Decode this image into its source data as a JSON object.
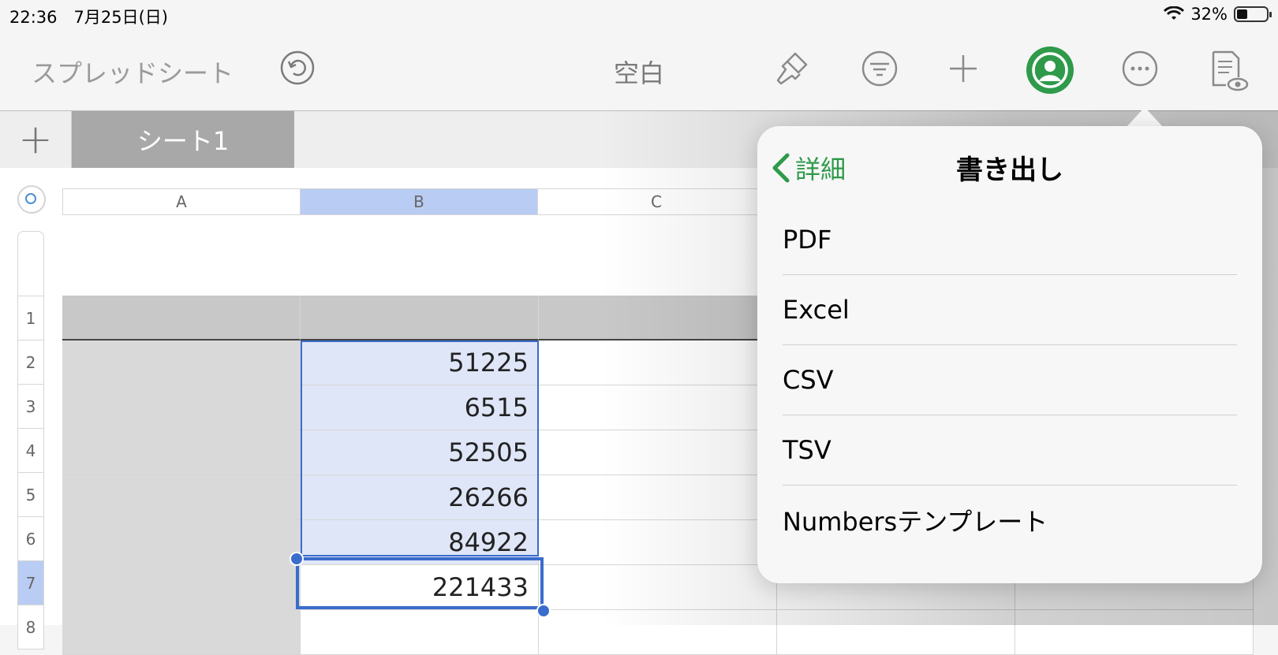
{
  "status_bar": {
    "time": "22:36　7月25日(日)",
    "battery": "32%",
    "battery_level": 0.32
  },
  "toolbar": {
    "app_title": "スプレッドシート",
    "document_title": "空白",
    "icons": [
      "undo-icon",
      "paintbrush-icon",
      "filter-icon",
      "plus-icon",
      "collaborate-icon",
      "more-icon",
      "reader-view-icon"
    ],
    "accent_color": "#2e9a4a"
  },
  "tabs": {
    "add_label": "+",
    "sheets": [
      {
        "label": "シート1"
      }
    ]
  },
  "grid": {
    "columns": [
      "A",
      "B",
      "C"
    ],
    "rows": [
      "1",
      "2",
      "3",
      "4",
      "5",
      "6",
      "7",
      "8"
    ],
    "col_b_values": [
      "",
      "51225",
      "6515",
      "52505",
      "26266",
      "84922",
      "221433"
    ],
    "selected_column": "B",
    "active_row": "7",
    "selection_color": "#3a6ccc"
  },
  "popover": {
    "back_label": "詳細",
    "title": "書き出し",
    "items": [
      "PDF",
      "Excel",
      "CSV",
      "TSV",
      "Numbersテンプレート"
    ]
  }
}
